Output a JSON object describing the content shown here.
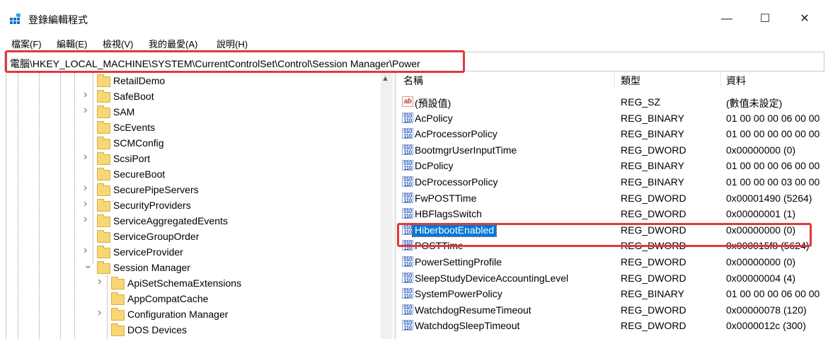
{
  "window": {
    "title": "登錄編輯程式",
    "minimize": "—",
    "maximize": "☐",
    "close": "✕"
  },
  "menu": [
    "檔案(F)",
    "編輯(E)",
    "檢視(V)",
    "我的最愛(A)",
    "說明(H)"
  ],
  "address": "電腦\\HKEY_LOCAL_MACHINE\\SYSTEM\\CurrentControlSet\\Control\\Session Manager\\Power",
  "tree": [
    {
      "label": "RetailDemo",
      "level": 1,
      "expander": ""
    },
    {
      "label": "SafeBoot",
      "level": 1,
      "expander": ">"
    },
    {
      "label": "SAM",
      "level": 1,
      "expander": ">"
    },
    {
      "label": "ScEvents",
      "level": 1,
      "expander": ""
    },
    {
      "label": "SCMConfig",
      "level": 1,
      "expander": ""
    },
    {
      "label": "ScsiPort",
      "level": 1,
      "expander": ">"
    },
    {
      "label": "SecureBoot",
      "level": 1,
      "expander": ""
    },
    {
      "label": "SecurePipeServers",
      "level": 1,
      "expander": ">"
    },
    {
      "label": "SecurityProviders",
      "level": 1,
      "expander": ">"
    },
    {
      "label": "ServiceAggregatedEvents",
      "level": 1,
      "expander": ">"
    },
    {
      "label": "ServiceGroupOrder",
      "level": 1,
      "expander": ""
    },
    {
      "label": "ServiceProvider",
      "level": 1,
      "expander": ">"
    },
    {
      "label": "Session Manager",
      "level": 1,
      "expander": "v"
    },
    {
      "label": "ApiSetSchemaExtensions",
      "level": 2,
      "expander": ">"
    },
    {
      "label": "AppCompatCache",
      "level": 2,
      "expander": ""
    },
    {
      "label": "Configuration Manager",
      "level": 2,
      "expander": ">"
    },
    {
      "label": "DOS Devices",
      "level": 2,
      "expander": ""
    }
  ],
  "columns": {
    "name": "名稱",
    "type": "類型",
    "data": "資料"
  },
  "values": [
    {
      "icon": "ab",
      "name": "(預設值)",
      "type": "REG_SZ",
      "data": "(數值未設定)"
    },
    {
      "icon": "bin",
      "name": "AcPolicy",
      "type": "REG_BINARY",
      "data": "01 00 00 00 06 00 00"
    },
    {
      "icon": "bin",
      "name": "AcProcessorPolicy",
      "type": "REG_BINARY",
      "data": "01 00 00 00 00 00 00"
    },
    {
      "icon": "bin",
      "name": "BootmgrUserInputTime",
      "type": "REG_DWORD",
      "data": "0x00000000 (0)"
    },
    {
      "icon": "bin",
      "name": "DcPolicy",
      "type": "REG_BINARY",
      "data": "01 00 00 00 06 00 00"
    },
    {
      "icon": "bin",
      "name": "DcProcessorPolicy",
      "type": "REG_BINARY",
      "data": "01 00 00 00 03 00 00"
    },
    {
      "icon": "bin",
      "name": "FwPOSTTime",
      "type": "REG_DWORD",
      "data": "0x00001490 (5264)"
    },
    {
      "icon": "bin",
      "name": "HBFlagsSwitch",
      "type": "REG_DWORD",
      "data": "0x00000001 (1)"
    },
    {
      "icon": "bin",
      "name": "HiberbootEnabled",
      "type": "REG_DWORD",
      "data": "0x00000000 (0)",
      "selected": true
    },
    {
      "icon": "bin",
      "name": "POSTTime",
      "type": "REG_DWORD",
      "data": "0x000015f8 (5624)"
    },
    {
      "icon": "bin",
      "name": "PowerSettingProfile",
      "type": "REG_DWORD",
      "data": "0x00000000 (0)"
    },
    {
      "icon": "bin",
      "name": "SleepStudyDeviceAccountingLevel",
      "type": "REG_DWORD",
      "data": "0x00000004 (4)"
    },
    {
      "icon": "bin",
      "name": "SystemPowerPolicy",
      "type": "REG_BINARY",
      "data": "01 00 00 00 06 00 00"
    },
    {
      "icon": "bin",
      "name": "WatchdogResumeTimeout",
      "type": "REG_DWORD",
      "data": "0x00000078 (120)"
    },
    {
      "icon": "bin",
      "name": "WatchdogSleepTimeout",
      "type": "REG_DWORD",
      "data": "0x0000012c (300)"
    }
  ],
  "colors": {
    "accent": "#0078d7",
    "highlight": "#e0383e",
    "folder": "#f7d675"
  }
}
